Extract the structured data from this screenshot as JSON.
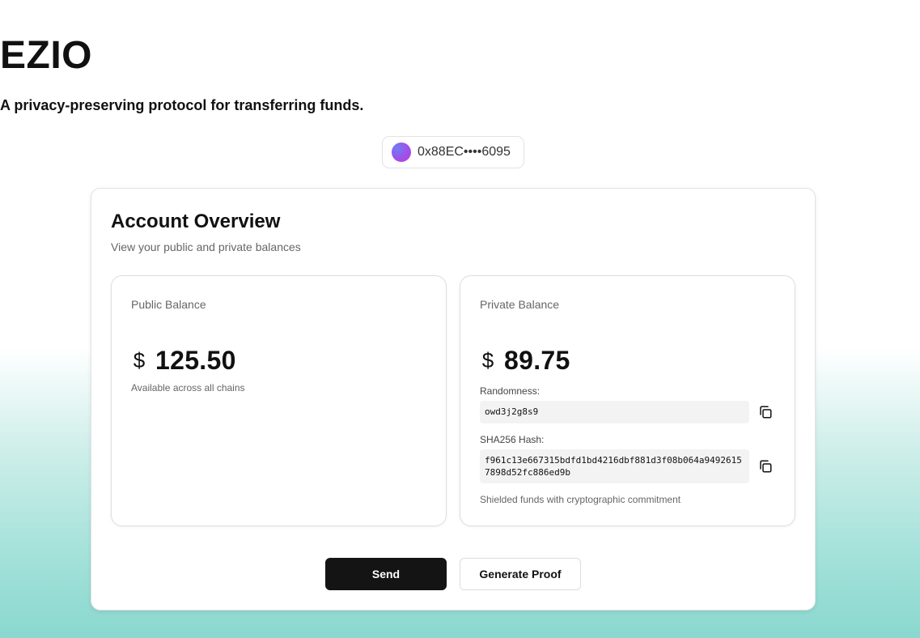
{
  "header": {
    "title": "EZIO",
    "subtitle": "A privacy-preserving protocol for transferring funds.",
    "wallet_address": "0x88EC••••6095"
  },
  "overview": {
    "title": "Account Overview",
    "description": "View your public and private balances",
    "public": {
      "label": "Public Balance",
      "currency_symbol": "$",
      "amount": "125.50",
      "note": "Available across all chains"
    },
    "private": {
      "label": "Private Balance",
      "currency_symbol": "$",
      "amount": "89.75",
      "randomness_label": "Randomness:",
      "randomness_value": "owd3j2g8s9",
      "hash_label": "SHA256 Hash:",
      "hash_value": "f961c13e667315bdfd1bd4216dbf881d3f08b064a94926157898d52fc886ed9b",
      "note": "Shielded funds with cryptographic commitment"
    },
    "actions": {
      "send_label": "Send",
      "proof_label": "Generate Proof"
    }
  },
  "icons": {
    "copy": "copy-icon",
    "dollar": "dollar-icon",
    "avatar": "avatar"
  }
}
